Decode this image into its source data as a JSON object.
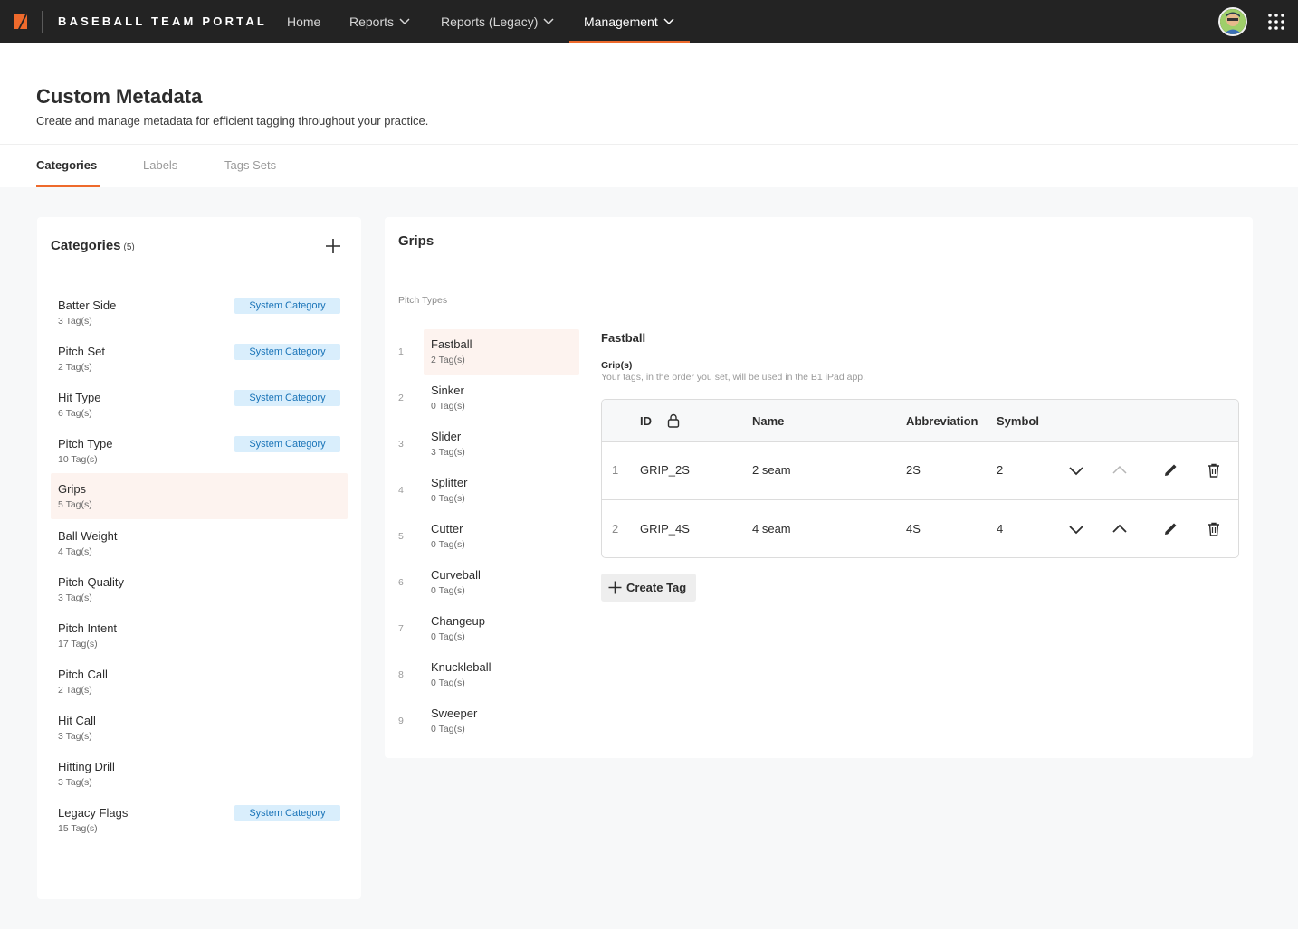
{
  "app": {
    "brand": "BASEBALL TEAM PORTAL",
    "accent_color": "#ee6a2c",
    "nav": [
      {
        "label": "Home"
      },
      {
        "label": "Reports"
      },
      {
        "label": "Reports (Legacy)"
      },
      {
        "label": "Management",
        "active": true
      }
    ]
  },
  "header": {
    "title": "Custom Metadata",
    "subtitle": "Create and manage metadata for efficient tagging throughout your practice.",
    "tabs": [
      {
        "label": "Categories",
        "active": true
      },
      {
        "label": "Labels"
      },
      {
        "label": "Tags Sets"
      }
    ]
  },
  "categories": {
    "title": "Categories",
    "count": "(5)",
    "system_badge": "System Category",
    "items": [
      {
        "name": "Batter Side",
        "tags": "3 Tag(s)",
        "system": true
      },
      {
        "name": "Pitch Set",
        "tags": "2 Tag(s)",
        "system": true
      },
      {
        "name": "Hit Type",
        "tags": "6 Tag(s)",
        "system": true
      },
      {
        "name": "Pitch Type",
        "tags": "10 Tag(s)",
        "system": true
      },
      {
        "name": "Grips",
        "tags": "5 Tag(s)",
        "selected": true
      },
      {
        "name": "Ball Weight",
        "tags": "4 Tag(s)"
      },
      {
        "name": "Pitch Quality",
        "tags": "3 Tag(s)"
      },
      {
        "name": "Pitch Intent",
        "tags": "17 Tag(s)"
      },
      {
        "name": "Pitch Call",
        "tags": "2 Tag(s)"
      },
      {
        "name": "Hit Call",
        "tags": "3 Tag(s)"
      },
      {
        "name": "Hitting Drill",
        "tags": "3 Tag(s)"
      },
      {
        "name": "Legacy Flags",
        "tags": "15 Tag(s)",
        "system": true
      }
    ]
  },
  "grips": {
    "title": "Grips",
    "pitch_types_heading": "Pitch Types",
    "pitch_types": [
      {
        "num": "1",
        "name": "Fastball",
        "tags": "2 Tag(s)",
        "selected": true
      },
      {
        "num": "2",
        "name": "Sinker",
        "tags": "0 Tag(s)"
      },
      {
        "num": "3",
        "name": "Slider",
        "tags": "3 Tag(s)"
      },
      {
        "num": "4",
        "name": "Splitter",
        "tags": "0 Tag(s)"
      },
      {
        "num": "5",
        "name": "Cutter",
        "tags": "0 Tag(s)"
      },
      {
        "num": "6",
        "name": "Curveball",
        "tags": "0 Tag(s)"
      },
      {
        "num": "7",
        "name": "Changeup",
        "tags": "0 Tag(s)"
      },
      {
        "num": "8",
        "name": "Knuckleball",
        "tags": "0 Tag(s)"
      },
      {
        "num": "9",
        "name": "Sweeper",
        "tags": "0 Tag(s)"
      }
    ],
    "detail": {
      "title": "Fastball",
      "grip_label": "Grip(s)",
      "grip_help": "Your tags, in the order you set, will be used in the B1 iPad app.",
      "columns": {
        "id": "ID",
        "name": "Name",
        "abbreviation": "Abbreviation",
        "symbol": "Symbol"
      },
      "rows": [
        {
          "num": "1",
          "id": "GRIP_2S",
          "name": "2 seam",
          "abbreviation": "2S",
          "symbol": "2",
          "move_up_enabled": false
        },
        {
          "num": "2",
          "id": "GRIP_4S",
          "name": "4 seam",
          "abbreviation": "4S",
          "symbol": "4",
          "move_up_enabled": true
        }
      ],
      "create_button": "Create Tag"
    }
  }
}
